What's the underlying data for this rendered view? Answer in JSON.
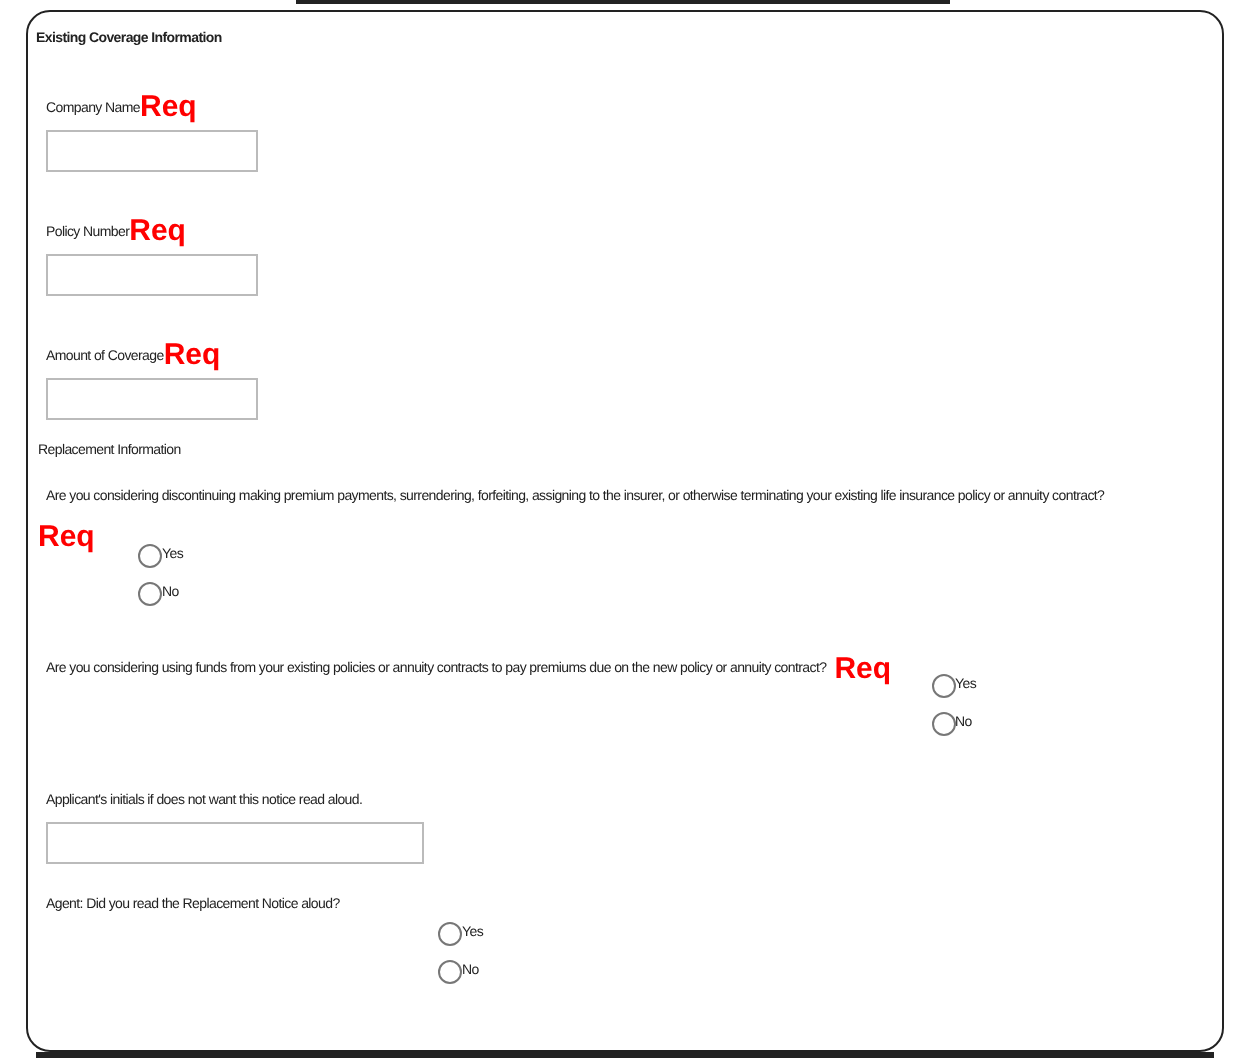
{
  "section_title": "Existing Coverage Information",
  "text_fields": [
    {
      "label": "Company Name",
      "req": "Req"
    },
    {
      "label": "Policy Number",
      "req": "Req"
    },
    {
      "label": "Amount of Coverage",
      "req": "Req"
    }
  ],
  "replacement": {
    "title": "Replacement Information",
    "questions": [
      {
        "kind": "stacked",
        "text": "Are you considering discontinuing making premium payments, surrendering, forfeiting, assigning to the insurer, or otherwise terminating your existing life insurance policy or annuity contract?",
        "req": "Req",
        "options": [
          {
            "label": "Yes",
            "selected": false
          },
          {
            "label": "No",
            "selected": false
          }
        ]
      },
      {
        "kind": "inline",
        "text": "Are you considering using funds from your existing policies or annuity contracts to pay premiums due on the new policy or annuity contract?",
        "req": "Req",
        "options": [
          {
            "label": "Yes",
            "selected": false
          },
          {
            "label": "No",
            "selected": false
          }
        ]
      }
    ]
  },
  "initials": {
    "label": "Applicant's initials if does not want this notice read aloud."
  },
  "agent_question": {
    "text": "Agent: Did you read the Replacement Notice aloud?",
    "options": [
      {
        "label": "Yes",
        "selected": false
      },
      {
        "label": "No",
        "selected": false
      }
    ]
  }
}
